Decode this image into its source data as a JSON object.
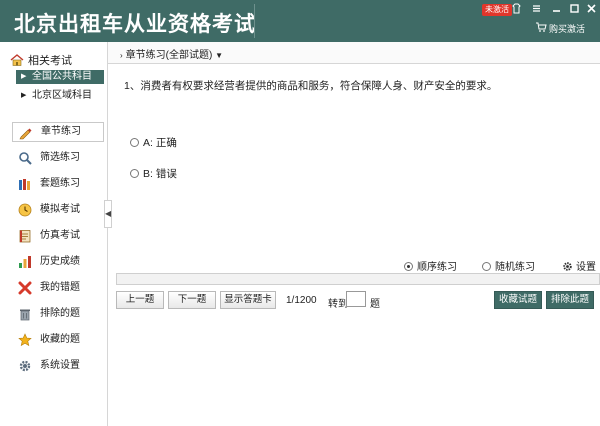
{
  "titlebar": {
    "title": "北京出租车从业资格考试",
    "badge": "未激活",
    "activate_label": "购买激活",
    "window_buttons": [
      "skin-icon",
      "menu-icon",
      "minimize-icon",
      "maximize-icon",
      "close-icon"
    ]
  },
  "sidebar": {
    "header": "相关考试",
    "sub_items": [
      {
        "label": "全国公共科目",
        "active": true
      },
      {
        "label": "北京区域科目",
        "active": false
      }
    ],
    "menu": [
      {
        "label": "章节练习",
        "icon": "chapter-icon",
        "active": true
      },
      {
        "label": "筛选练习",
        "icon": "search-icon",
        "active": false
      },
      {
        "label": "套题练习",
        "icon": "books-icon",
        "active": false
      },
      {
        "label": "模拟考试",
        "icon": "clock-icon",
        "active": false
      },
      {
        "label": "仿真考试",
        "icon": "notebook-icon",
        "active": false
      },
      {
        "label": "历史成绩",
        "icon": "bar-chart-icon",
        "active": false
      },
      {
        "label": "我的错题",
        "icon": "x-mark-icon",
        "active": false
      },
      {
        "label": "排除的题",
        "icon": "trash-icon",
        "active": false
      },
      {
        "label": "收藏的题",
        "icon": "star-icon",
        "active": false
      },
      {
        "label": "系统设置",
        "icon": "gear-icon",
        "active": false
      }
    ]
  },
  "main": {
    "breadcrumb": "章节练习(全部试题)",
    "question": "1、消费者有权要求经营者提供的商品和服务，符合保障人身、财产安全的要求。",
    "options": [
      "A: 正确",
      "B: 错误"
    ],
    "modes": {
      "sequential": "顺序练习",
      "random": "随机练习",
      "settings": "设置",
      "selected": "sequential"
    },
    "toolbar": {
      "prev": "上一题",
      "next": "下一题",
      "show_card": "显示答题卡",
      "counter": "1/1200",
      "goto_label": "转到",
      "goto_suffix": "题",
      "goto_value": "",
      "collect": "收藏试题",
      "exclude": "排除此题"
    }
  },
  "colors": {
    "accent": "#3f6b66",
    "badge": "#e0362b"
  }
}
